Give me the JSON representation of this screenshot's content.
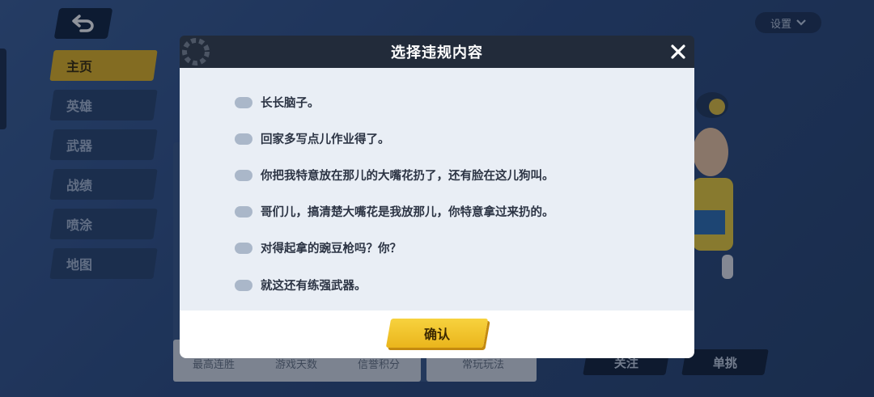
{
  "background": {
    "nav_items": [
      "主页",
      "英雄",
      "武器",
      "战绩",
      "喷涂",
      "地图"
    ],
    "active_nav": 0,
    "settings_label": "设置",
    "stats_labels": [
      "最高连胜",
      "游戏天数",
      "信誉积分",
      "常玩玩法"
    ],
    "follow_label": "关注",
    "duel_label": "单挑"
  },
  "dialog": {
    "title": "选择违规内容",
    "options": [
      "长长脑子。",
      "回家多写点儿作业得了。",
      "你把我特意放在那儿的大嘴花扔了，还有脸在这儿狗叫。",
      "哥们儿，搞清楚大嘴花是我放那儿，你特意拿过来扔的。",
      "对得起拿的豌豆枪吗？你？",
      "就这还有练强武器。"
    ],
    "confirm_label": "确认"
  },
  "colors": {
    "accent": "#eab51c",
    "header": "#222b3a",
    "toggle_off": "#aab7c9"
  }
}
